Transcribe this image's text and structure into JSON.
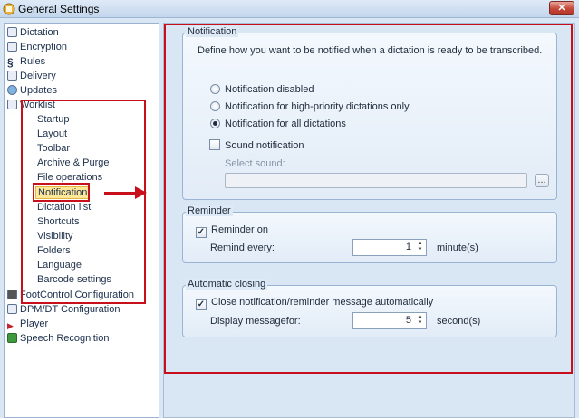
{
  "window": {
    "title": "General Settings",
    "close_label": "✕"
  },
  "sidebar": {
    "items": [
      {
        "label": "Dictation",
        "icon": "speaker-icon"
      },
      {
        "label": "Encryption",
        "icon": "lock-icon"
      },
      {
        "label": "Rules",
        "icon": "section-icon"
      },
      {
        "label": "Delivery",
        "icon": "ftp-icon"
      },
      {
        "label": "Updates",
        "icon": "globe-icon"
      },
      {
        "label": "Worklist",
        "icon": "list-icon"
      },
      {
        "label": "FootControl Configuration",
        "icon": "footcontrol-icon"
      },
      {
        "label": "DPM/DT Configuration",
        "icon": "device-icon"
      },
      {
        "label": "Player",
        "icon": "player-icon"
      },
      {
        "label": "Speech Recognition",
        "icon": "speech-icon"
      }
    ],
    "worklist_children": [
      "Startup",
      "Layout",
      "Toolbar",
      "Archive & Purge",
      "File operations",
      "Notification",
      "Dictation list",
      "Shortcuts",
      "Visibility",
      "Folders",
      "Language",
      "Barcode settings"
    ],
    "selected": "Notification"
  },
  "notification": {
    "legend": "Notification",
    "description": "Define how you want to be notified when a dictation is ready to be transcribed.",
    "options": [
      {
        "label": "Notification disabled",
        "selected": false
      },
      {
        "label": "Notification for high-priority dictations only",
        "selected": false
      },
      {
        "label": "Notification for all dictations",
        "selected": true
      }
    ],
    "sound_label": "Sound notification",
    "sound_checked": false,
    "select_sound_label": "Select sound:",
    "select_sound_value": "",
    "browse_label": "..."
  },
  "reminder": {
    "legend": "Reminder",
    "reminder_on_label": "Reminder on",
    "reminder_on_checked": true,
    "remind_every_label": "Remind every:",
    "remind_every_value": "1",
    "unit": "minute(s)"
  },
  "auto_close": {
    "legend": "Automatic closing",
    "close_label": "Close notification/reminder message automatically",
    "close_checked": true,
    "display_label": "Display messagefor:",
    "display_value": "5",
    "unit": "second(s)"
  },
  "colors": {
    "annotation_red": "#c8101d",
    "selected_highlight": "#fde89a"
  }
}
